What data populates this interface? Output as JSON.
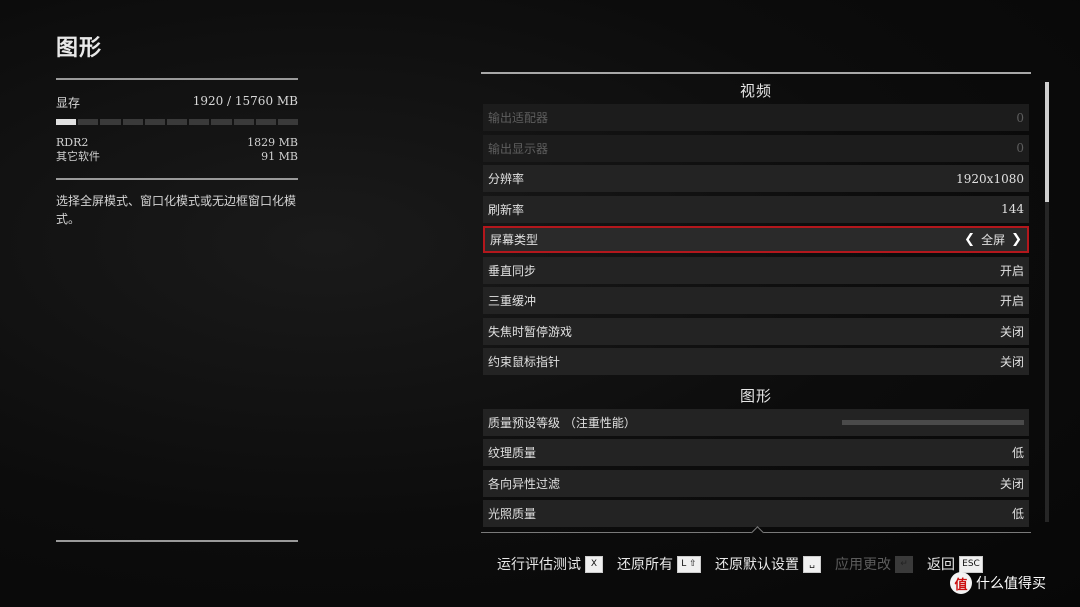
{
  "left": {
    "title": "图形",
    "memory": {
      "label": "显存",
      "value": "1920  / 15760  MB",
      "segments_total": 11,
      "segments_filled": 1
    },
    "usage": [
      {
        "label": "RDR2",
        "value": "1829  MB"
      },
      {
        "label": "其它软件",
        "value": "91  MB"
      }
    ],
    "description": "选择全屏模式、窗口化模式或无边框窗口化模式。"
  },
  "sections": [
    {
      "title": "视频",
      "rows": [
        {
          "label": "输出适配器",
          "value": "0",
          "state": "disabled"
        },
        {
          "label": "输出显示器",
          "value": "0",
          "state": "disabled"
        },
        {
          "label": "分辨率",
          "value": "1920x1080",
          "state": "normal"
        },
        {
          "label": "刷新率",
          "value": "144",
          "state": "normal"
        },
        {
          "label": "屏幕类型",
          "value": "全屏",
          "state": "selected"
        },
        {
          "label": "垂直同步",
          "value": "开启",
          "state": "normal"
        },
        {
          "label": "三重缓冲",
          "value": "开启",
          "state": "normal"
        },
        {
          "label": "失焦时暂停游戏",
          "value": "关闭",
          "state": "normal"
        },
        {
          "label": "约束鼠标指针",
          "value": "关闭",
          "state": "normal"
        }
      ]
    },
    {
      "title": "图形",
      "rows": [
        {
          "label": "质量预设等级   （注重性能）",
          "value": "",
          "state": "slider"
        },
        {
          "label": "纹理质量",
          "value": "低",
          "state": "normal"
        },
        {
          "label": "各向异性过滤",
          "value": "关闭",
          "state": "normal"
        },
        {
          "label": "光照质量",
          "value": "低",
          "state": "normal"
        }
      ]
    }
  ],
  "actions": [
    {
      "label": "运行评估测试",
      "key": "X",
      "enabled": true
    },
    {
      "label": "还原所有",
      "key": "L ⇧",
      "enabled": true
    },
    {
      "label": "还原默认设置",
      "key": "␣",
      "enabled": true
    },
    {
      "label": "应用更改",
      "key": "↵",
      "enabled": false
    },
    {
      "label": "返回",
      "key": "ESC",
      "enabled": true
    }
  ],
  "watermark": {
    "logo": "值",
    "text": "什么值得买"
  },
  "colors": {
    "accent": "#b3171c",
    "background": "#0b0b0b",
    "row": "#232323"
  }
}
